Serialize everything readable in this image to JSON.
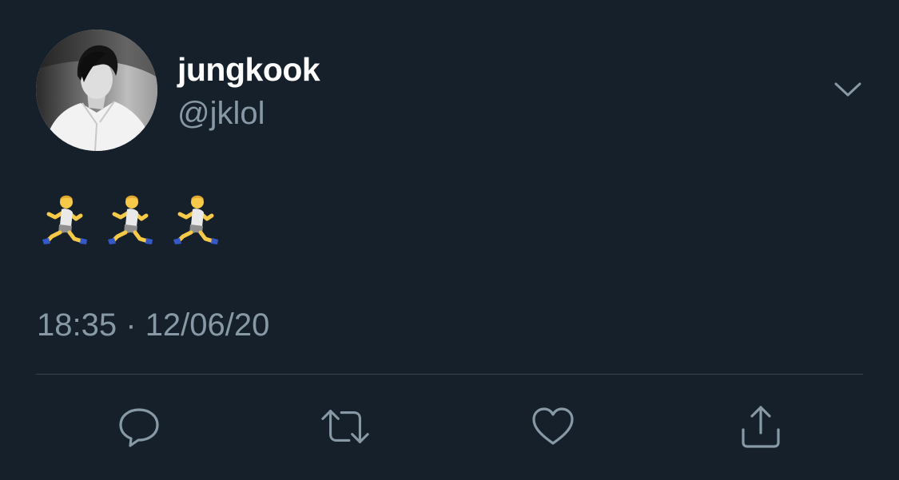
{
  "tweet": {
    "author": {
      "display_name": "jungkook",
      "handle": "@jklol"
    },
    "text_emojis": [
      {
        "icon": "man-running-emoji"
      },
      {
        "icon": "man-running-emoji"
      },
      {
        "icon": "man-running-emoji"
      }
    ],
    "time": "18:35",
    "separator": "·",
    "date": "12/06/20",
    "actions": [
      {
        "name": "reply",
        "icon": "speech-bubble-icon"
      },
      {
        "name": "retweet",
        "icon": "retweet-arrows-icon"
      },
      {
        "name": "like",
        "icon": "heart-icon"
      },
      {
        "name": "share",
        "icon": "upload-arrow-icon"
      }
    ]
  },
  "colors": {
    "background": "#15202b",
    "primary_text": "#ffffff",
    "secondary_text": "#8899a6",
    "divider": "#38444d"
  }
}
